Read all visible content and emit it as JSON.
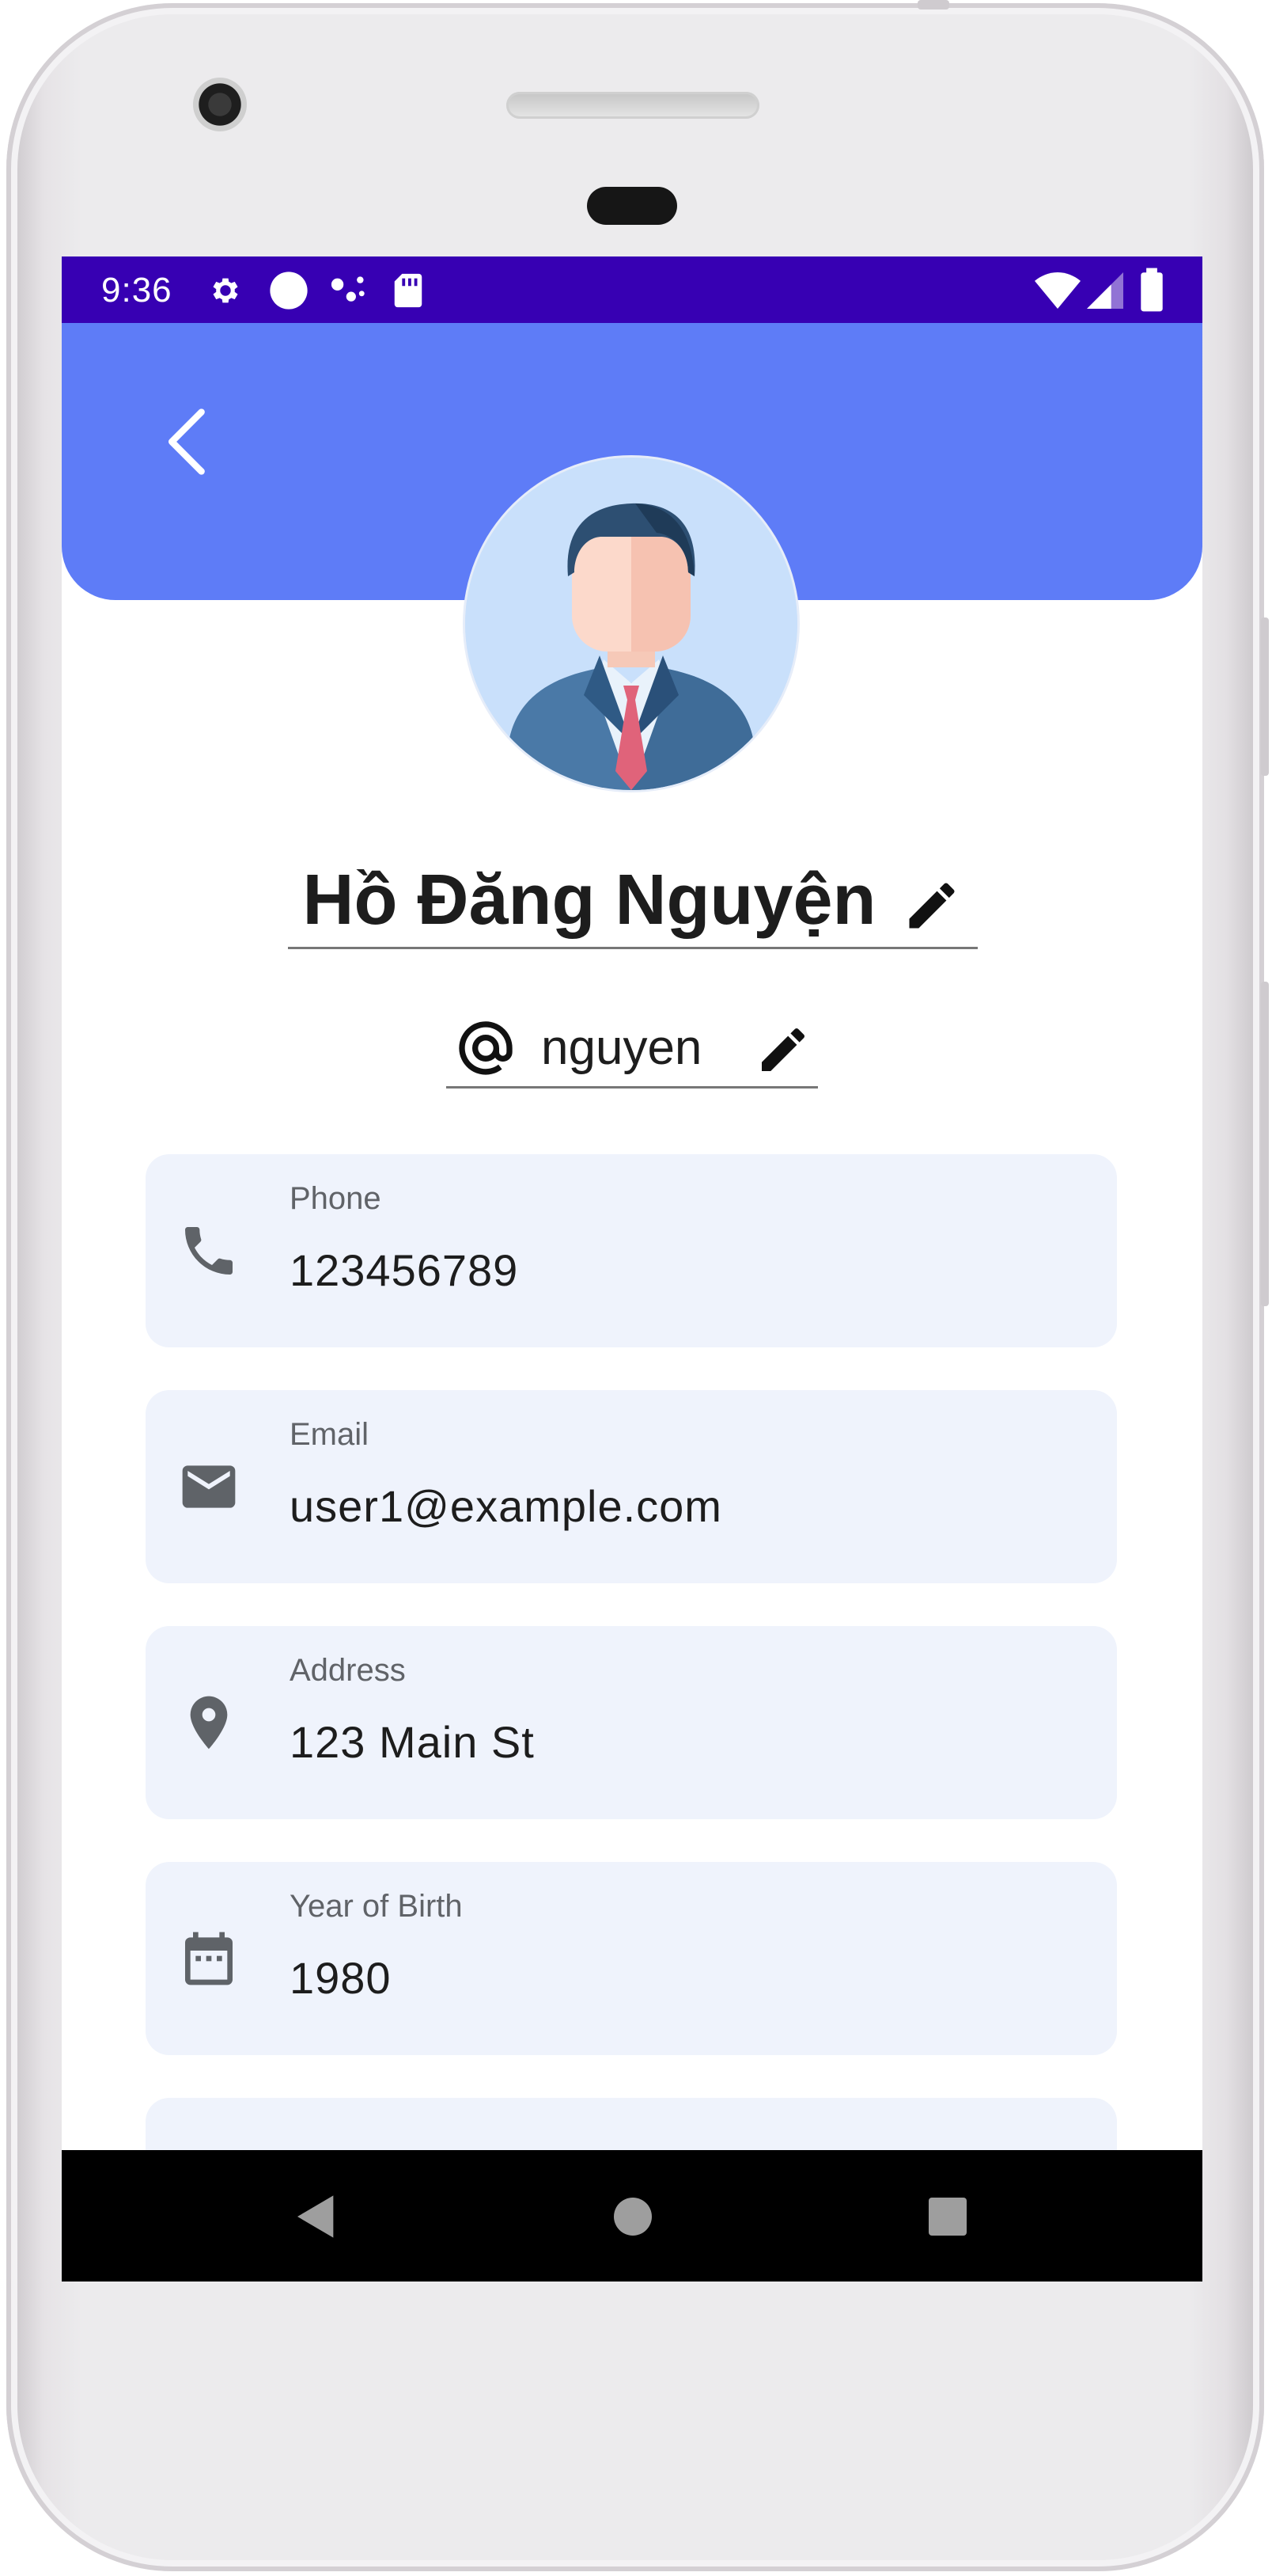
{
  "status_bar": {
    "time": "9:36",
    "left_icons": [
      "gear-icon",
      "circle-notification-icon",
      "dots-notification-icon",
      "sd-card-icon"
    ],
    "right_icons": [
      "wifi-icon",
      "signal-icon",
      "battery-icon"
    ],
    "background": "#3700b3"
  },
  "header": {
    "background": "#5e7cf7",
    "back_icon": "chevron-left-icon"
  },
  "profile": {
    "name": "Hồ Đăng Nguyện",
    "username": "nguyen",
    "at_symbol": "@"
  },
  "fields": [
    {
      "label": "Phone",
      "value": "123456789",
      "icon": "phone-icon"
    },
    {
      "label": "Email",
      "value": "user1@example.com",
      "icon": "mail-icon"
    },
    {
      "label": "Address",
      "value": "123 Main St",
      "icon": "location-pin-icon"
    },
    {
      "label": "Year of Birth",
      "value": "1980",
      "icon": "calendar-icon"
    }
  ],
  "colors": {
    "card_background": "#eff3fc",
    "label": "#606368",
    "text": "#1d1d1d"
  },
  "nav_bar": {
    "buttons": [
      "back-triangle-icon",
      "home-circle-icon",
      "recents-square-icon"
    ]
  }
}
